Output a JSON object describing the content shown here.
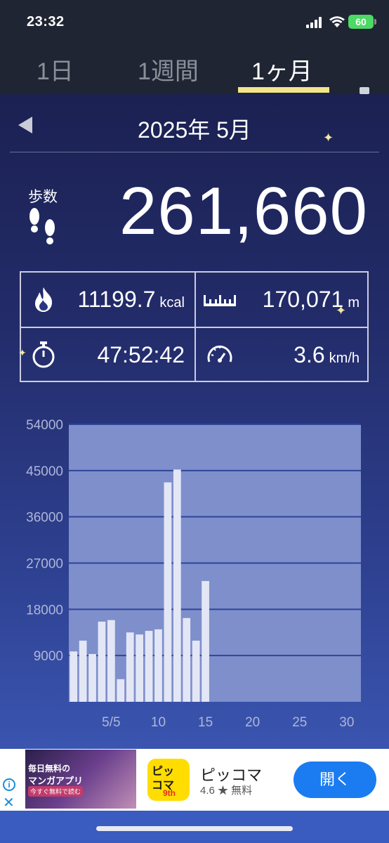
{
  "status_bar": {
    "time": "23:32",
    "battery": "60"
  },
  "tabs": [
    {
      "label": "1日",
      "active": false
    },
    {
      "label": "1週間",
      "active": false
    },
    {
      "label": "1ヶ月",
      "active": true
    }
  ],
  "month": {
    "title": "2025年 5月"
  },
  "steps": {
    "label": "歩数",
    "value": "261,660"
  },
  "stats": {
    "calories": {
      "value": "11199.7",
      "unit": "kcal"
    },
    "distance": {
      "value": "170,071",
      "unit": "m"
    },
    "duration": {
      "value": "47:52:42"
    },
    "speed": {
      "value": "3.6",
      "unit": "km/h"
    }
  },
  "chart_data": {
    "type": "bar",
    "x": [
      1,
      2,
      3,
      4,
      5,
      6,
      7,
      8,
      9,
      10,
      11,
      12,
      13,
      14,
      15
    ],
    "values": [
      9800,
      11900,
      9300,
      15600,
      15900,
      4400,
      13500,
      13100,
      13800,
      14100,
      42700,
      45200,
      16300,
      11900,
      23500
    ],
    "x_ticks": [
      "5/5",
      "10",
      "15",
      "20",
      "25",
      "30"
    ],
    "x_tick_positions": [
      5,
      10,
      15,
      20,
      25,
      30
    ],
    "y_ticks": [
      "54000",
      "45000",
      "36000",
      "27000",
      "18000",
      "9000"
    ],
    "y_tick_values": [
      54000,
      45000,
      36000,
      27000,
      18000,
      9000
    ],
    "ylim": [
      0,
      54000
    ],
    "xlim": [
      0.5,
      31.5
    ],
    "grid": true,
    "bar_color": "#e3e7f5",
    "plot_bg": "#7e8fcc",
    "title": "",
    "xlabel": "",
    "ylabel": ""
  },
  "ad": {
    "banner_line1": "毎日無料の",
    "banner_line2": "マンガアプリ",
    "banner_badge": "今すぐ無料で読む",
    "app_icon_text1": "ピッ",
    "app_icon_text2": "コマ",
    "app_icon_text3": "9th",
    "app_name": "ピッコマ",
    "rating": "4.6 ★  無料",
    "open_button": "開く",
    "info_icon": "i",
    "close_icon": "✕"
  },
  "icons": {
    "footprints": "footprints-icon",
    "fire": "fire-icon",
    "ruler": "ruler-icon",
    "stopwatch": "stopwatch-icon",
    "speedometer": "speedometer-icon",
    "menu": "menu-icon",
    "back": "back-arrow-icon"
  }
}
